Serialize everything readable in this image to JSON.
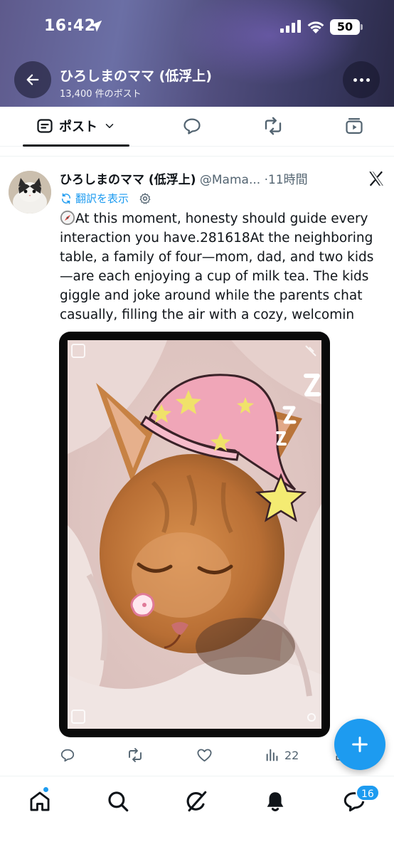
{
  "status_bar": {
    "time": "16:42",
    "battery": "50"
  },
  "header": {
    "title": "ひろしまのママ (低浮上)",
    "subtitle": "13,400 件のポスト"
  },
  "tabs": [
    {
      "label": "ポスト",
      "icon": "post-icon",
      "active": true
    },
    {
      "label": "",
      "icon": "reply-bubble-icon",
      "active": false
    },
    {
      "label": "",
      "icon": "repost-icon",
      "active": false
    },
    {
      "label": "",
      "icon": "media-icon",
      "active": false
    }
  ],
  "tweet": {
    "display_name": "ひろしまのママ (低浮上)",
    "handle": "@Mama...",
    "time": "·11時間",
    "translate_label": "翻訳を表示",
    "text": "At this moment, honesty should guide every interaction you have.281618At the neighboring table, a family of four—mom, dad, and two kids—are each enjoying a cup of milk tea. The kids giggle and joke around while the parents chat casually, filling the air with a cozy, welcomin",
    "views": "22"
  },
  "bottom_nav": {
    "items": [
      "home-icon",
      "search-icon",
      "grok-icon",
      "notifications-icon",
      "messages-icon"
    ],
    "messages_badge": "16"
  },
  "colors": {
    "accent": "#1d9bf0",
    "text": "#0f1419",
    "muted": "#536471"
  }
}
